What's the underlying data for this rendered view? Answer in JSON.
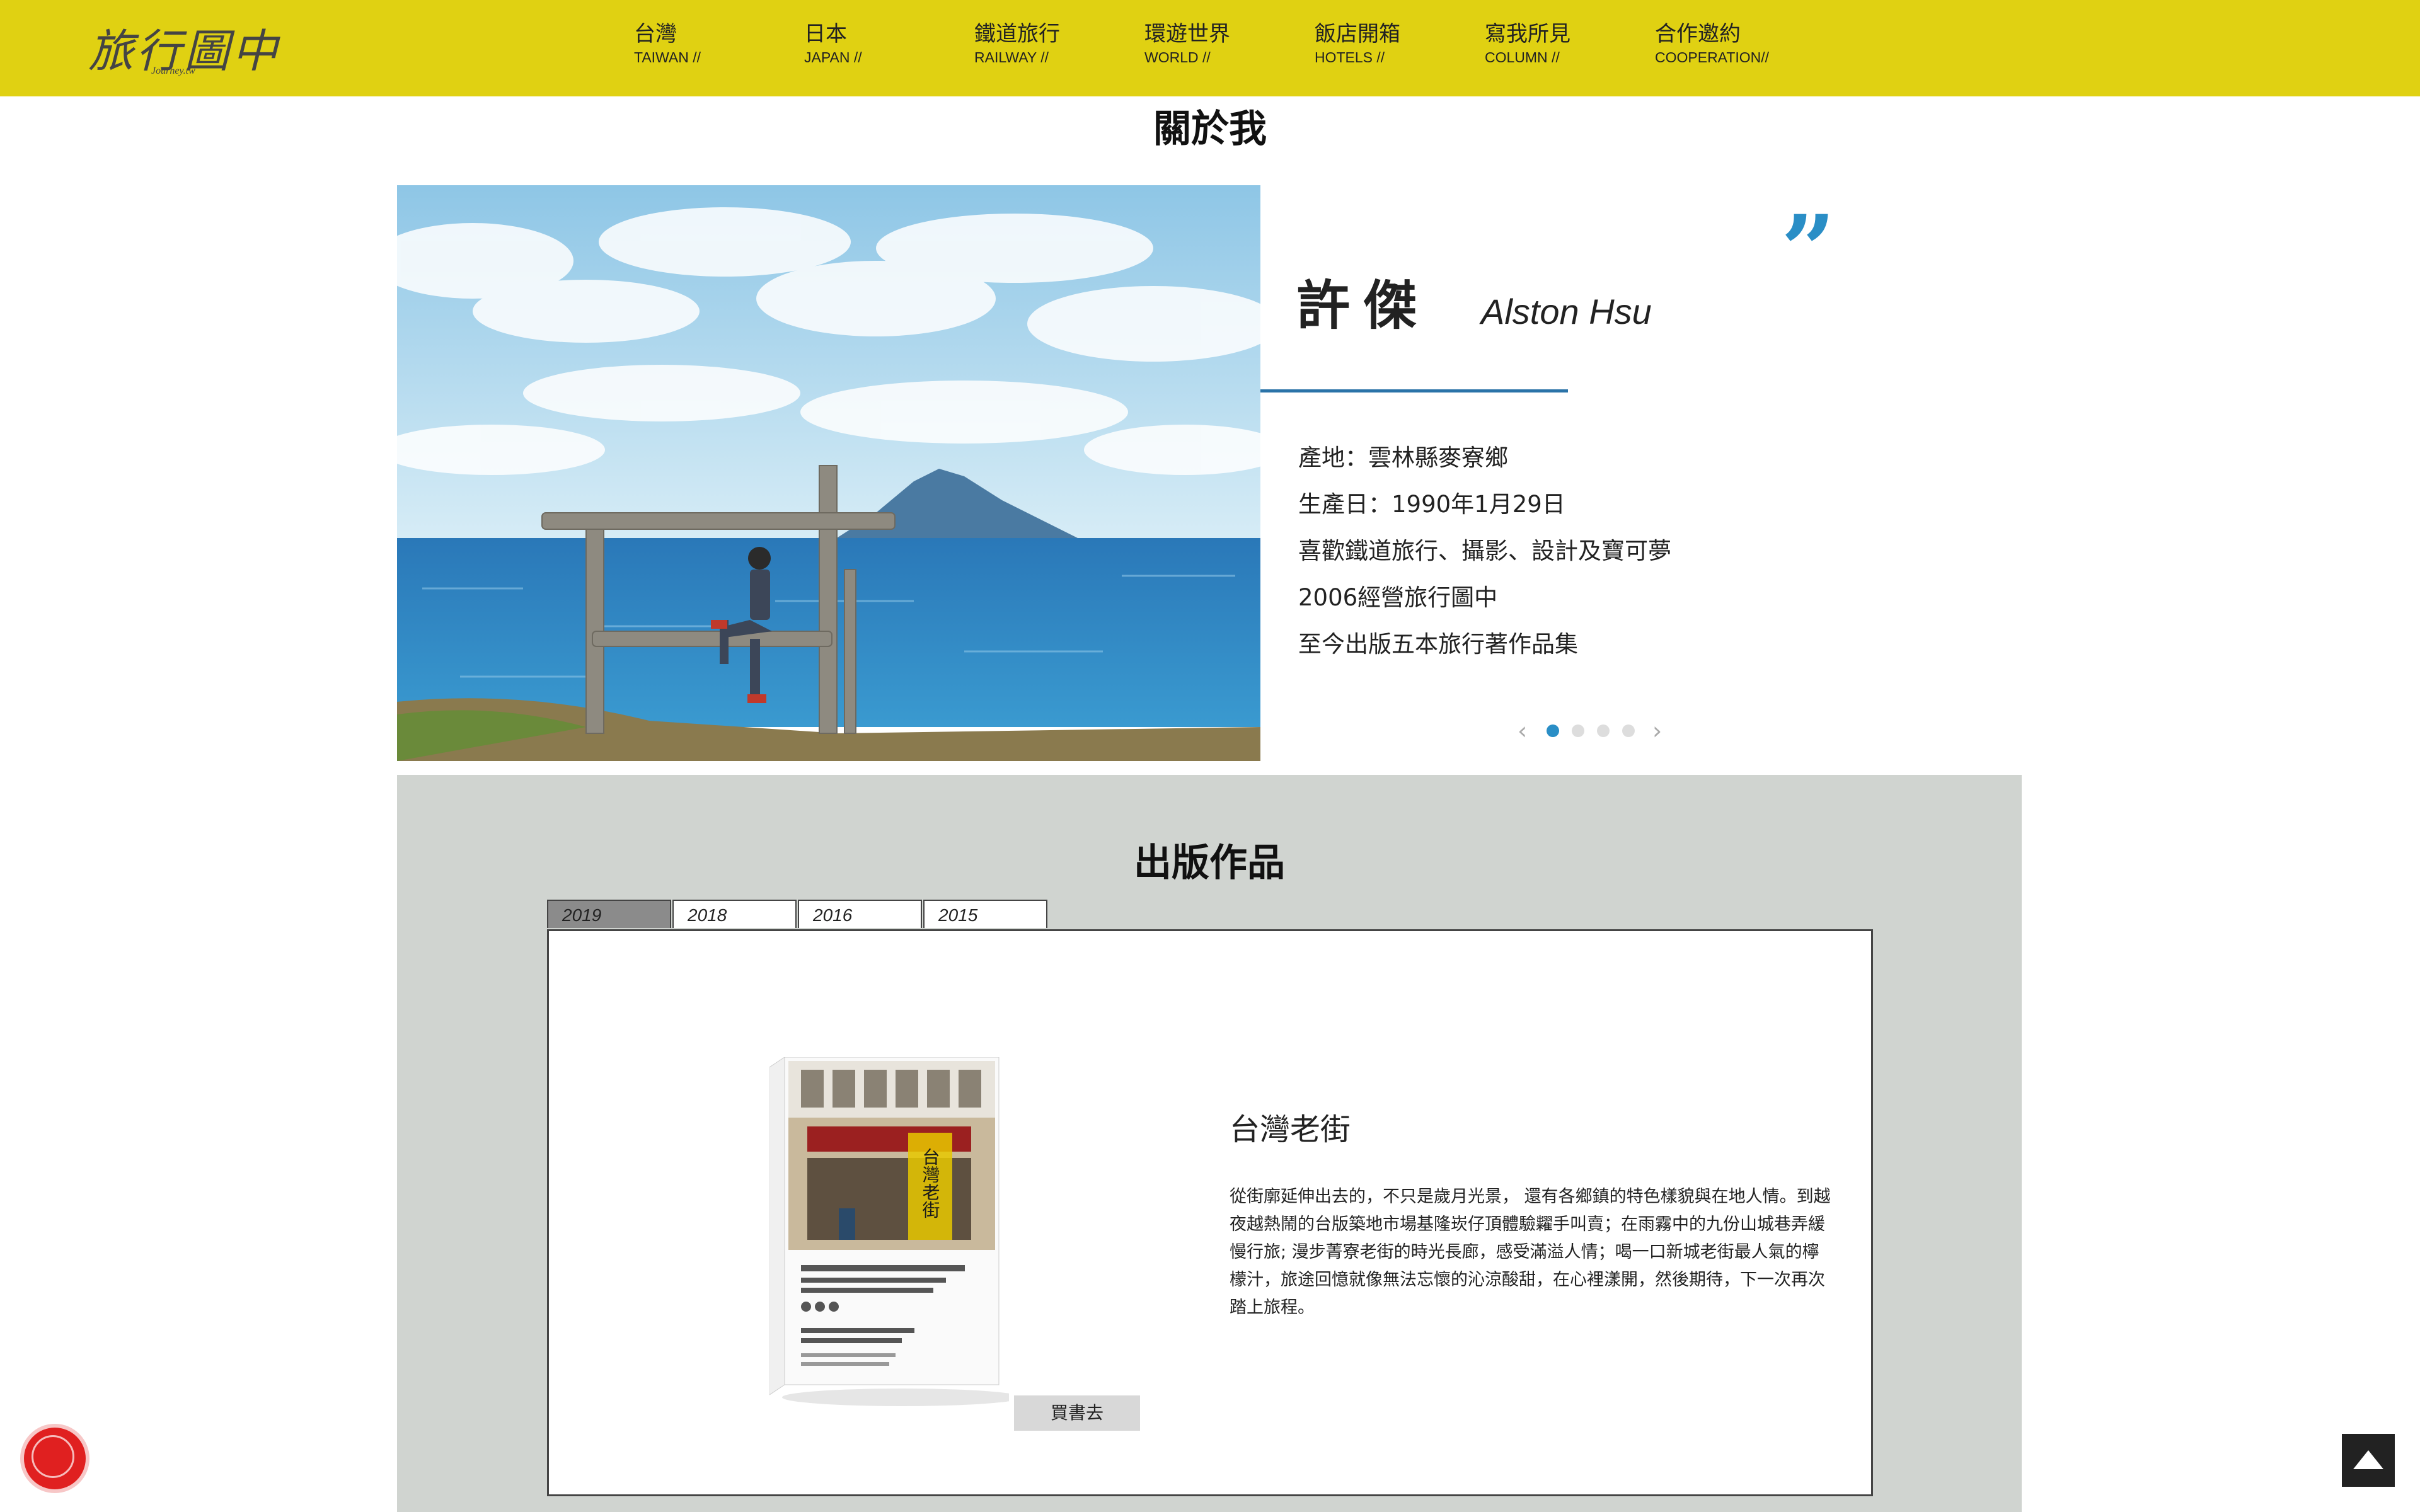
{
  "header": {
    "logo_main": "旅行圖中",
    "logo_sub": "Journey.tw",
    "nav": [
      {
        "zh": "台灣",
        "en": "TAIWAN //"
      },
      {
        "zh": "日本",
        "en": "JAPAN //"
      },
      {
        "zh": "鐵道旅行",
        "en": "RAILWAY //"
      },
      {
        "zh": "環遊世界",
        "en": "WORLD //"
      },
      {
        "zh": "飯店開箱",
        "en": "HOTELS //"
      },
      {
        "zh": "寫我所見",
        "en": "COLUMN //"
      },
      {
        "zh": "合作邀約",
        "en": "COOPERATION//"
      }
    ]
  },
  "about": {
    "title": "關於我",
    "quote_mark": "”",
    "name_zh": "許傑",
    "name_en": "Alston Hsu",
    "bio": [
      "產地：雲林縣麥寮鄉",
      "生產日：1990年1月29日",
      "喜歡鐵道旅行、攝影、設計及寶可夢",
      "2006經營旅行圖中",
      "至今出版五本旅行著作品集"
    ],
    "carousel": {
      "prev": "‹",
      "next": "›",
      "total_slides": 4,
      "active_slide": 1
    }
  },
  "publications": {
    "title": "出版作品",
    "tabs": [
      "2019",
      "2018",
      "2016",
      "2015"
    ],
    "active_tab": "2019",
    "book": {
      "title": "台灣老街",
      "description": "從街廓延伸出去的，不只是歲月光景， 還有各鄉鎮的特色樣貌與在地人情。到越夜越熱鬧的台版築地市場基隆崁仔頂體驗糶手叫賣；在雨霧中的九份山城巷弄緩慢行旅; 漫步菁寮老街的時光長廊，感受滿溢人情；喝一口新城老街最人氣的檸檬汁，旅途回憶就像無法忘懷的沁涼酸甜，在心裡漾開，然後期待，下一次再次踏上旅程。",
      "cover_text": "台灣老街",
      "buy_label": "買書去"
    }
  },
  "colors": {
    "header_bg": "#e0d112",
    "accent_blue": "#2a8ec6",
    "section_bg": "#d0d4d0",
    "notification_red": "#e02020"
  },
  "icons": {
    "notification": "notification-bell-icon",
    "back_to_top": "arrow-up-icon"
  }
}
